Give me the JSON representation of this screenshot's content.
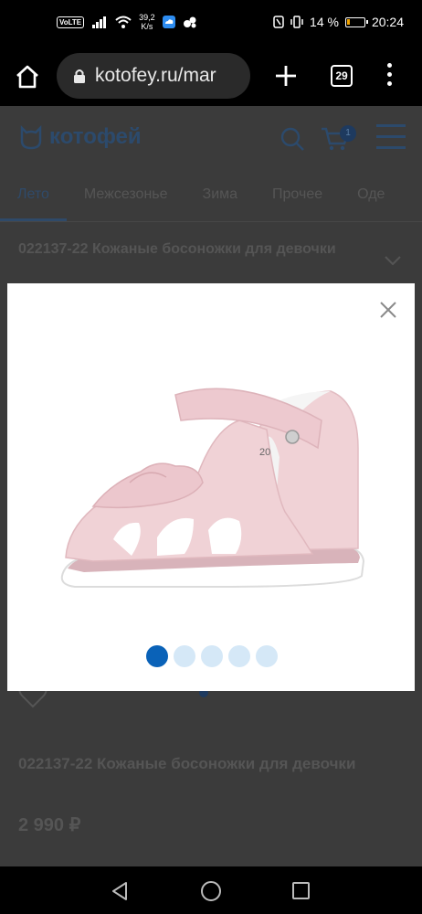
{
  "status_bar": {
    "volte": "VoLTE",
    "net_speed_value": "39,2",
    "net_speed_unit": "K/s",
    "battery": "14 %",
    "time": "20:24"
  },
  "browser": {
    "url": "kotofey.ru/mar",
    "tab_count": "29"
  },
  "site": {
    "logo_text": "котофей",
    "cart_count": "1",
    "categories": [
      "Лето",
      "Межсезонье",
      "Зима",
      "Прочее",
      "Оде"
    ],
    "active_category": "Лето",
    "breadcrumb_title": "022137-22 Кожаные босоножки для девочки",
    "product_title": "022137-22 Кожаные босоножки для девочки",
    "price": "2 990 ₽"
  },
  "gallery": {
    "size_mark": "20",
    "current_slide": 1,
    "slide_count": 5
  },
  "colors": {
    "accent": "#0a62b8",
    "dot_inactive": "#d5e8f7",
    "shoe_pink": "#f0d2d6"
  }
}
